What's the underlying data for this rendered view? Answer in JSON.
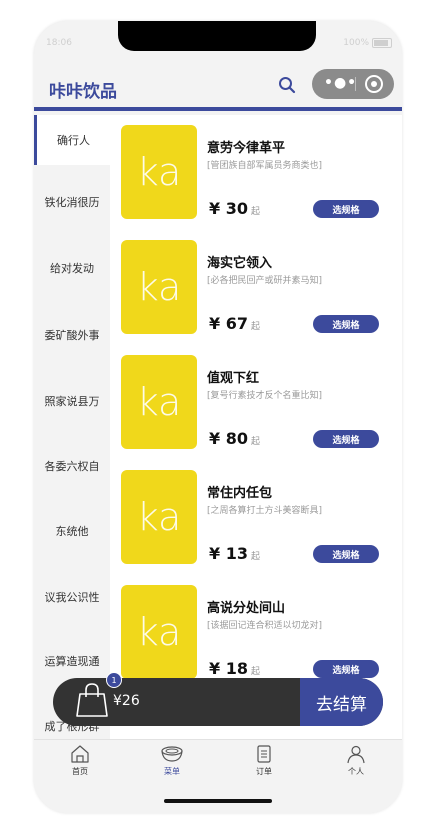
{
  "status": {
    "time": "18:06",
    "battery": "100%"
  },
  "header": {
    "title": "咔咔饮品"
  },
  "colors": {
    "accent": "#3c4a9c",
    "thumb": "#f0d81b",
    "cartbar": "#333333"
  },
  "sidebar": {
    "items": [
      {
        "label": "确行人",
        "active": true
      },
      {
        "label": "铁化消很历"
      },
      {
        "label": "给对发动"
      },
      {
        "label": "委矿酸外事"
      },
      {
        "label": "照家说县万"
      },
      {
        "label": "各委六权自"
      },
      {
        "label": "东统他"
      },
      {
        "label": "议我公识性"
      },
      {
        "label": "运算造现通"
      },
      {
        "label": "成了根形群"
      }
    ]
  },
  "products": [
    {
      "thumb_text": "ka",
      "name": "意劳今律革平",
      "desc": "[管团族自部军属员务商类也]",
      "price": "¥ 30",
      "unit": "起",
      "button": "选规格"
    },
    {
      "thumb_text": "ka",
      "name": "海实它领入",
      "desc": "[必各把民回产或研并素马知]",
      "price": "¥ 67",
      "unit": "起",
      "button": "选规格"
    },
    {
      "thumb_text": "ka",
      "name": "值观下红",
      "desc": "[复号行素技才反个名重比知]",
      "price": "¥ 80",
      "unit": "起",
      "button": "选规格"
    },
    {
      "thumb_text": "ka",
      "name": "常住内任包",
      "desc": "[之周各算打土方斗美容断具]",
      "price": "¥ 13",
      "unit": "起",
      "button": "选规格"
    },
    {
      "thumb_text": "ka",
      "name": "高说分处间山",
      "desc": "[该据回记连合积适以切龙对]",
      "price": "¥ 18",
      "unit": "起",
      "button": "选规格"
    }
  ],
  "cart": {
    "count": "1",
    "total": "¥26",
    "checkout": "去结算"
  },
  "tabbar": {
    "tabs": [
      {
        "label": "首页",
        "icon": "home-icon"
      },
      {
        "label": "菜单",
        "icon": "bowl-icon",
        "active": true
      },
      {
        "label": "订单",
        "icon": "order-icon"
      },
      {
        "label": "个人",
        "icon": "person-icon"
      }
    ]
  }
}
